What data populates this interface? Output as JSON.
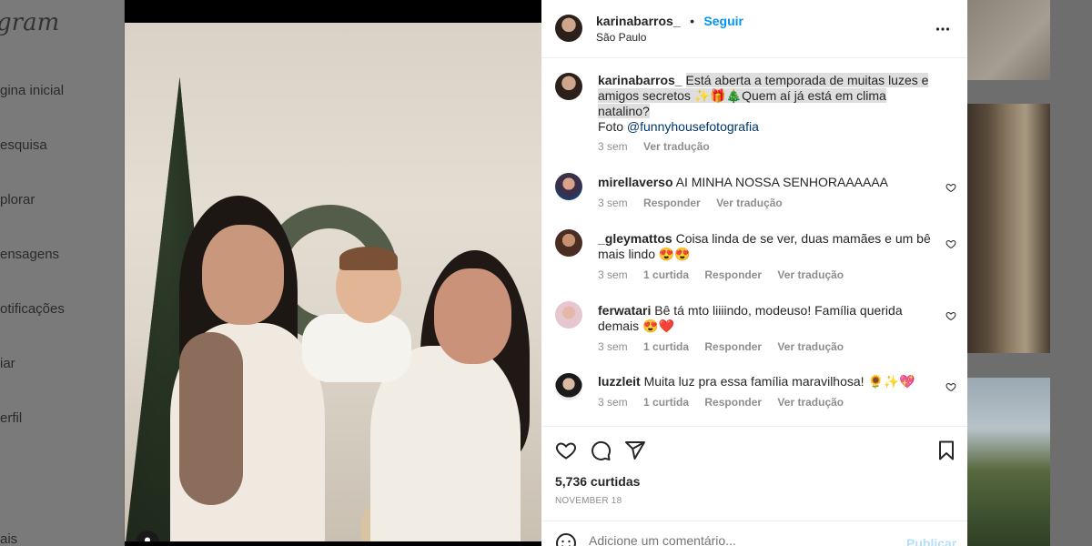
{
  "background": {
    "logo": "gram",
    "nav": [
      "gina inicial",
      "esquisa",
      "plorar",
      "ensagens",
      "otificações",
      "iar",
      "erfil",
      "ais"
    ]
  },
  "post": {
    "author": "karinabarros_",
    "dot": "•",
    "follow_label": "Seguir",
    "location": "São Paulo",
    "more_icon": "more-horizontal-icon",
    "caption": {
      "user": "karinabarros_",
      "text": "Está aberta a temporada de muitas luzes e amigos secretos ✨🎁🎄Quem aí já está em clima natalino?",
      "credit_prefix": "Foto ",
      "credit_handle": "@funnyhousefotografia",
      "time": "3 sem",
      "translate": "Ver tradução"
    },
    "comments": [
      {
        "user": "mirellaverso",
        "text": "AI MINHA NOSSA SENHORAAAAAA",
        "time": "3 sem",
        "likes": "",
        "reply": "Responder",
        "translate": "Ver tradução"
      },
      {
        "user": "_gleymattos",
        "text": "Coisa linda de se ver, duas mamães e um bê mais lindo 😍😍",
        "time": "3 sem",
        "likes": "1 curtida",
        "reply": "Responder",
        "translate": "Ver tradução"
      },
      {
        "user": "ferwatari",
        "text": "Bê tá mto liiiindo, modeuso! Família querida demais 😍❤️",
        "time": "3 sem",
        "likes": "1 curtida",
        "reply": "Responder",
        "translate": "Ver tradução"
      },
      {
        "user": "luzzleit",
        "text": "Muita luz pra essa família maravilhosa! 🌻✨💖",
        "time": "3 sem",
        "likes": "1 curtida",
        "reply": "Responder",
        "translate": "Ver tradução"
      }
    ],
    "like_count": "5,736 curtidas",
    "date": "NOVEMBER 18",
    "comment_placeholder": "Adicione um comentário...",
    "publish_label": "Publicar"
  },
  "colors": {
    "link": "#00376b",
    "accent": "#0095f6",
    "muted": "#8e8e8e"
  }
}
